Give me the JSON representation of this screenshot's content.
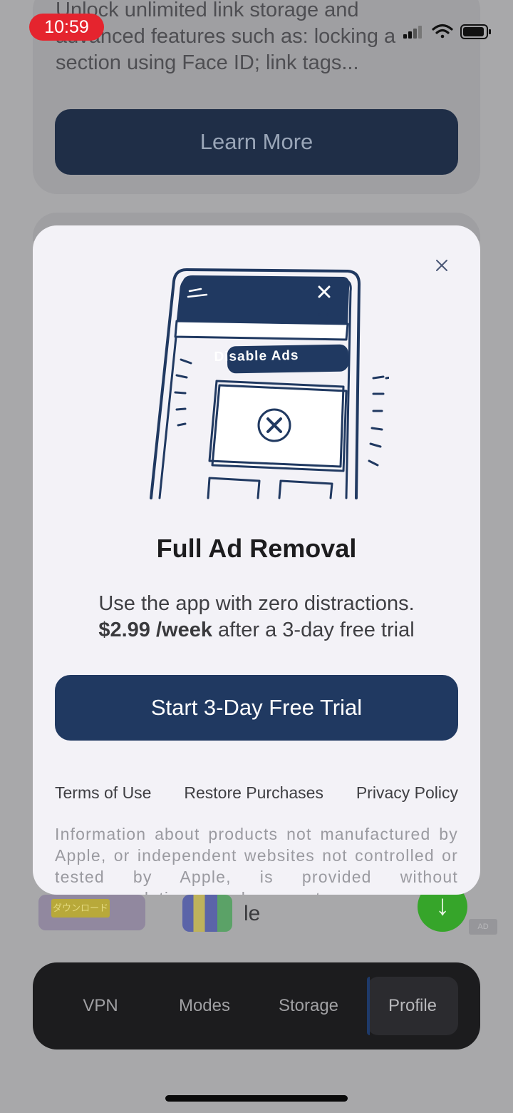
{
  "status_bar": {
    "time": "10:59"
  },
  "background": {
    "card_text": "Unlock unlimited link storage and advanced features such as: locking a section using Face ID; link tags...",
    "learn_more_label": "Learn More",
    "ad": {
      "label": "ダウンロード",
      "text": "le",
      "badge": "AD"
    }
  },
  "modal": {
    "illustration_label": "Disable Ads",
    "title": "Full Ad Removal",
    "description_line1": "Use the app with zero distractions.",
    "price": "$2.99 /week",
    "price_suffix": " after a 3-day free trial",
    "cta_label": "Start 3-Day Free Trial",
    "links": {
      "terms": "Terms of Use",
      "restore": "Restore Purchases",
      "privacy": "Privacy Policy"
    },
    "disclaimer": "Information about products not manufactured by Apple, or independent websites not controlled or tested by Apple, is provided without recommendation or endorsement."
  },
  "tabbar": {
    "tabs": [
      "VPN",
      "Modes",
      "Storage",
      "Profile"
    ],
    "active": "Profile"
  },
  "colors": {
    "accent": "#203961",
    "modal_bg": "#f3f2f7",
    "tabbar_bg": "#1c1c1e",
    "time_pill": "#e5242e"
  }
}
